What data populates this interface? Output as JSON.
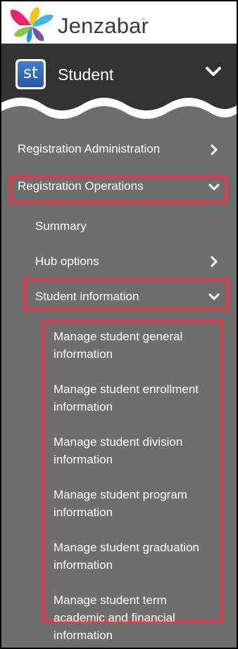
{
  "header": {
    "brand": "Jenzabar",
    "trademark": "™"
  },
  "module": {
    "icon_text": "st",
    "title": "Student"
  },
  "nav": {
    "registration_administration": "Registration Administration",
    "registration_operations": "Registration Operations",
    "summary": "Summary",
    "hub_options": "Hub options",
    "student_information": "Student information"
  },
  "student_information_items": [
    "Manage student general information",
    "Manage student enrollment information",
    "Manage student division information",
    "Manage student program information",
    "Manage student graduation information",
    "Manage student term academic and financial information"
  ],
  "colors": {
    "sidebar_bg": "#6e6e6e",
    "module_bg": "#333333",
    "highlight": "#e8394b",
    "text": "#ffffff"
  }
}
